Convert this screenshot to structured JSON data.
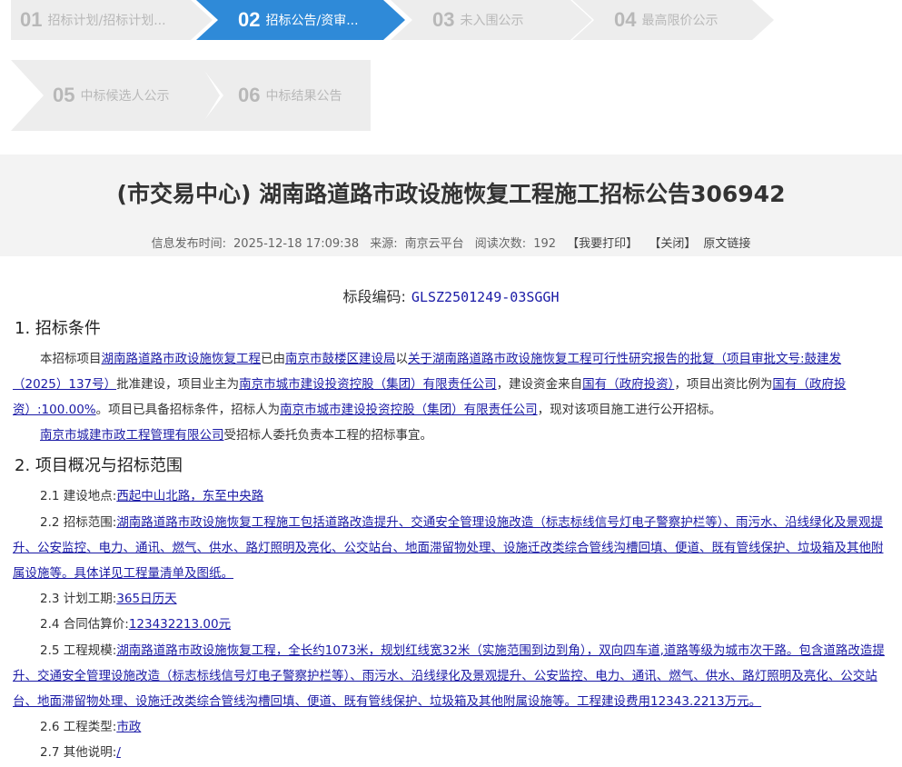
{
  "steps": [
    {
      "num": "01",
      "label": "招标计划/招标计划..."
    },
    {
      "num": "02",
      "label": "招标公告/资审..."
    },
    {
      "num": "03",
      "label": "未入围公示"
    },
    {
      "num": "04",
      "label": "最高限价公示"
    },
    {
      "num": "05",
      "label": "中标候选人公示"
    },
    {
      "num": "06",
      "label": "中标结果公告"
    }
  ],
  "title": "(市交易中心) 湖南路道路市政设施恢复工程施工招标公告306942",
  "meta": {
    "publish_label": "信息发布时间:",
    "publish_time": "2025-12-18 17:09:38",
    "source_label": "来源:",
    "source": "南京云平台",
    "reads_label": "阅读次数:",
    "reads": "192",
    "print": "【我要打印】",
    "close": "【关闭】",
    "original": "原文链接"
  },
  "segment": {
    "label": "标段编码:",
    "code": "GLSZ2501249-03SGGH"
  },
  "s1": {
    "heading": "1. 招标条件",
    "p1_a": "本招标项目",
    "p1_b": "湖南路道路市政设施恢复工程",
    "p1_c": "已由",
    "p1_d": "南京市鼓楼区建设局",
    "p1_e": "以",
    "p1_f": "关于湖南路道路市政设施恢复工程可行性研究报告的批复（项目审批文号:鼓建发（2025）137号）",
    "p1_g": "批准建设，项目业主为",
    "p1_h": "南京市城市建设投资控股（集团）有限责任公司",
    "p1_i": "，建设资金来自",
    "p1_j": "国有（政府投资）",
    "p1_k": "，项目出资比例为",
    "p1_l": "国有（政府投资）:100.00%",
    "p1_m": "。项目已具备招标条件，招标人为",
    "p1_n": "南京市城市建设投资控股（集团）有限责任公司",
    "p1_o": "，现对该项目施工进行公开招标。",
    "p2_a": "南京市城建市政工程管理有限公司",
    "p2_b": "受招标人委托负责本工程的招标事宜。"
  },
  "s2": {
    "heading": "2. 项目概况与招标范围",
    "i1_label": "2.1 建设地点:",
    "i1_value": "西起中山北路，东至中央路",
    "i2_label": "2.2 招标范围:",
    "i2_value": "湖南路道路市政设施恢复工程施工包括道路改造提升、交通安全管理设施改造（标志标线信号灯电子警察护栏等）、雨污水、沿线绿化及景观提升、公安监控、电力、通讯、燃气、供水、路灯照明及亮化、公交站台、地面滞留物处理、设施迁改类综合管线沟槽回填、便道、既有管线保护、垃圾箱及其他附属设施等。具体详见工程量清单及图纸。",
    "i3_label": "2.3 计划工期:",
    "i3_value": "365日历天",
    "i4_label": "2.4 合同估算价:",
    "i4_value": "123432213.00元",
    "i5_label": "2.5 工程规模:",
    "i5_value": "湖南路道路市政设施恢复工程，全长约1073米，规划红线宽32米（实施范围到边到角），双向四车道,道路等级为城市次干路。包含道路改造提升、交通安全管理设施改造（标志标线信号灯电子警察护栏等）、雨污水、沿线绿化及景观提升、公安监控、电力、通讯、燃气、供水、路灯照明及亮化、公交站台、地面滞留物处理、设施迁改类综合管线沟槽回填、便道、既有管线保护、垃圾箱及其他附属设施等。工程建设费用12343.2213万元。",
    "i6_label": "2.6 工程类型:",
    "i6_value": "市政",
    "i7_label": "2.7 其他说明:",
    "i7_value": "/"
  }
}
